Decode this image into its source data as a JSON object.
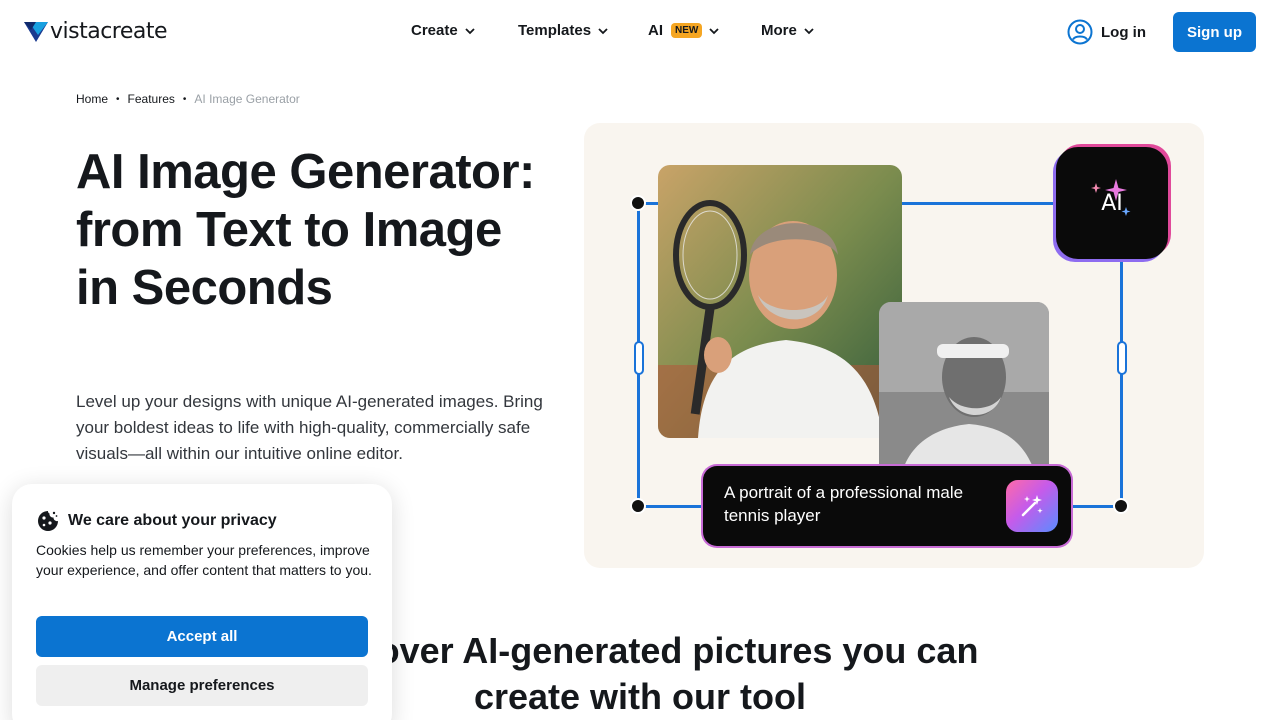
{
  "brand": {
    "name": "vistacreate",
    "accent": "#0b74d1"
  },
  "nav": {
    "items": [
      {
        "label": "Create"
      },
      {
        "label": "Templates"
      },
      {
        "label": "AI",
        "badge": "NEW"
      },
      {
        "label": "More"
      }
    ],
    "login": "Log in",
    "signup": "Sign up"
  },
  "breadcrumb": {
    "items": [
      "Home",
      "Features"
    ],
    "current": "AI Image Generator"
  },
  "hero": {
    "title": "AI Image Generator: from Text to Image in Seconds",
    "description": "Level up your designs with unique AI-generated images. Bring your boldest ideas to life with high-quality, commercially safe visuals—all within our intuitive online editor."
  },
  "illustration": {
    "ai_tile_label": "AI",
    "prompt_text": "A portrait of a professional male tennis player"
  },
  "section": {
    "title_line1": "Discover AI-generated pictures you can",
    "title_line2": "create with our tool"
  },
  "cookie": {
    "title": "We care about your privacy",
    "body": "Cookies help us remember your preferences, improve your experience, and offer content that matters to you.",
    "accept": "Accept all",
    "manage": "Manage preferences"
  }
}
